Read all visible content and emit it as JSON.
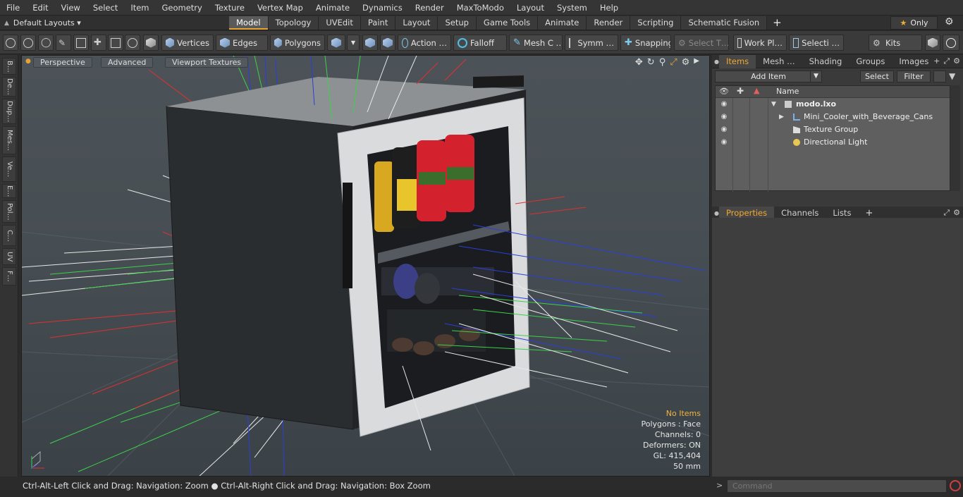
{
  "menu": [
    "File",
    "Edit",
    "View",
    "Select",
    "Item",
    "Geometry",
    "Texture",
    "Vertex Map",
    "Animate",
    "Dynamics",
    "Render",
    "MaxToModo",
    "Layout",
    "System",
    "Help"
  ],
  "layouts": {
    "label": "Default Layouts ▾"
  },
  "tabs": [
    "Model",
    "Topology",
    "UVEdit",
    "Paint",
    "Layout",
    "Setup",
    "Game Tools",
    "Animate",
    "Render",
    "Scripting",
    "Schematic Fusion"
  ],
  "only_label": "Only",
  "toolbar": {
    "vertices": "Vertices",
    "edges": "Edges",
    "polygons": "Polygons",
    "action": "Action …",
    "falloff": "Falloff",
    "mesh": "Mesh C …",
    "symm": "Symm …",
    "snapping": "Snapping",
    "select_t": "Select T…",
    "workpl": "Work Pl…",
    "selecti": "Selecti …",
    "kits": "Kits"
  },
  "left_tabs": [
    "B…",
    "De…",
    "Dup…",
    "Mes…",
    "Ve…",
    "E…",
    "Pol…",
    "C…",
    "UV",
    "F…"
  ],
  "viewport": {
    "perspective": "Perspective",
    "advanced": "Advanced",
    "textures": "Viewport Textures",
    "info": {
      "no_items": "No Items",
      "polygons": "Polygons : Face",
      "channels": "Channels: 0",
      "deformers": "Deformers: ON",
      "gl": "GL: 415,404",
      "scale": "50 mm"
    }
  },
  "items_panel": {
    "tabs": [
      "Items",
      "Mesh …",
      "Shading",
      "Groups",
      "Images"
    ],
    "add_item": "Add Item",
    "select": "Select",
    "filter": "Filter",
    "column_name": "Name",
    "rows": [
      {
        "label": "modo.lxo",
        "level": 0
      },
      {
        "label": "Mini_Cooler_with_Beverage_Cans",
        "level": 1
      },
      {
        "label": "Texture Group",
        "level": 1
      },
      {
        "label": "Directional Light",
        "level": 1
      }
    ]
  },
  "props_panel": {
    "tabs": [
      "Properties",
      "Channels",
      "Lists"
    ]
  },
  "status": "Ctrl-Alt-Left Click and Drag: Navigation: Zoom ● Ctrl-Alt-Right Click and Drag: Navigation: Box Zoom",
  "command": {
    "placeholder": "Command"
  },
  "colors": {
    "accent": "#e8a230",
    "bg": "#2b2b2b",
    "panel": "#3a3a3a"
  }
}
